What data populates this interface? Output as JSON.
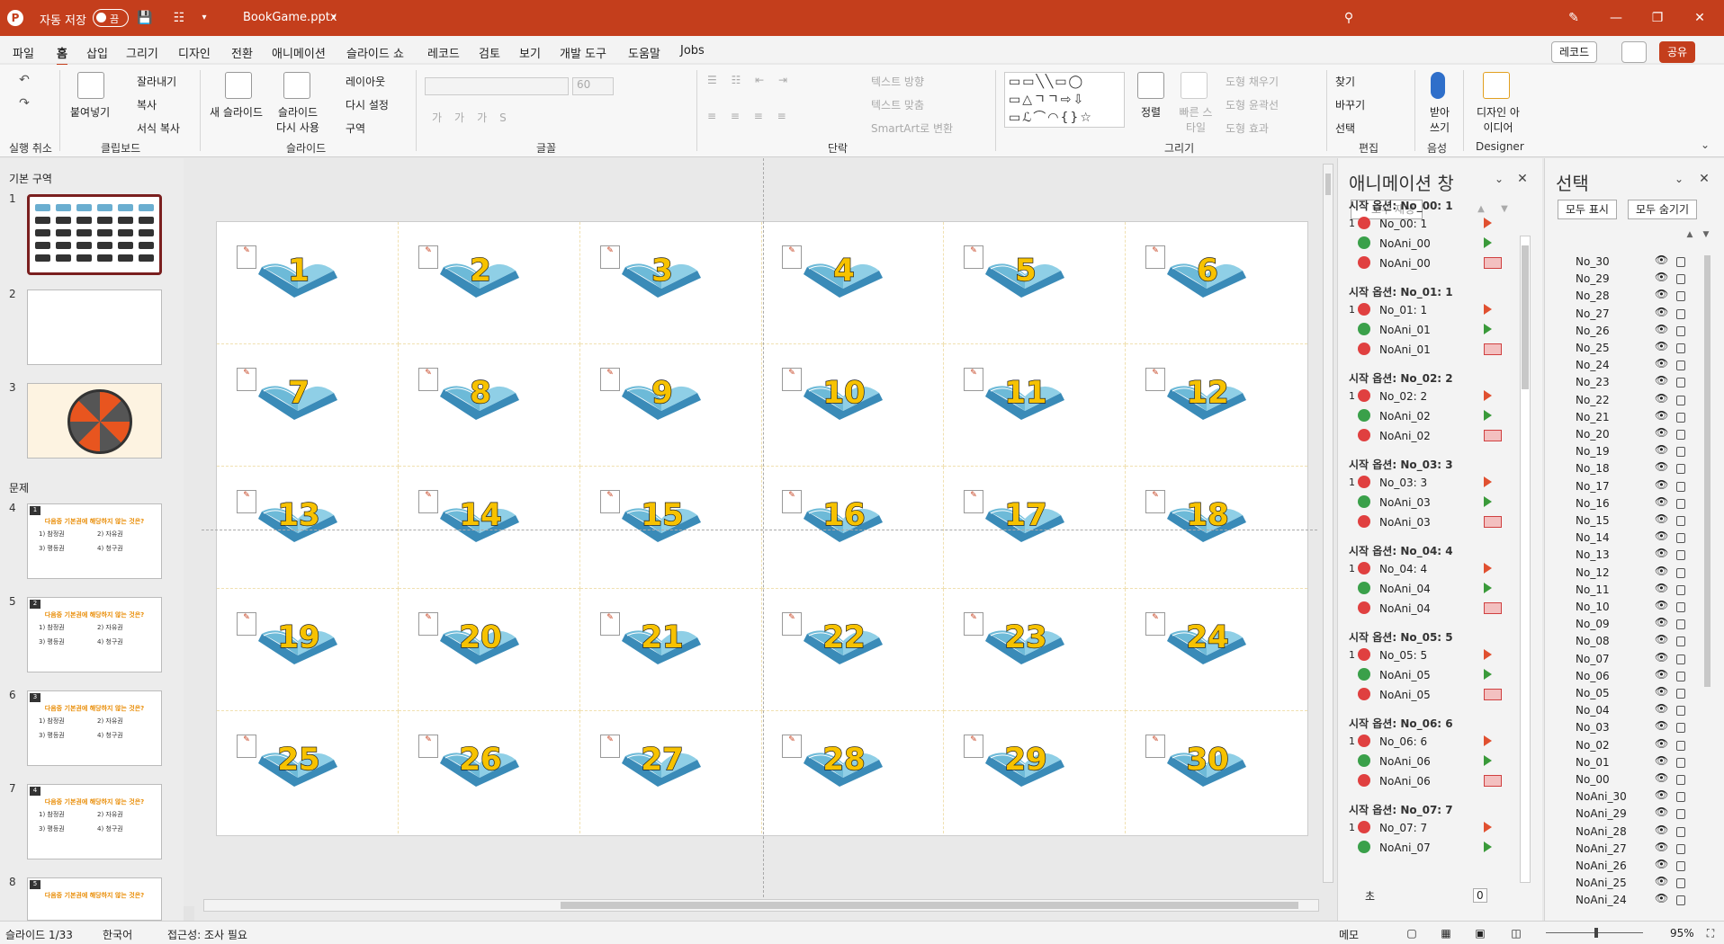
{
  "titlebar": {
    "autosave_label": "자동 저장",
    "autosave_state": "끔",
    "filename": "BookGame.pptx"
  },
  "menu": [
    "파일",
    "홈",
    "삽입",
    "그리기",
    "디자인",
    "전환",
    "애니메이션",
    "슬라이드 쇼",
    "레코드",
    "검토",
    "보기",
    "개발 도구",
    "도움말",
    "Jobs"
  ],
  "menu_active": "홈",
  "right_buttons": {
    "record": "레코드",
    "share": "공유"
  },
  "ribbon": {
    "undo_group": "실행 취소",
    "clipboard": {
      "paste": "붙여넣기",
      "cut": "잘라내기",
      "copy": "복사",
      "format_painter": "서식 복사",
      "group": "클립보드"
    },
    "slides": {
      "new_slide": "새 슬라이드",
      "reuse": "슬라이드 다시 사용",
      "layout": "레이아웃",
      "reset": "다시 설정",
      "section": "구역",
      "group": "슬라이드"
    },
    "font": {
      "size": "60",
      "group": "글꼴"
    },
    "paragraph": {
      "text_direction": "텍스트 방향",
      "align_text": "텍스트 맞춤",
      "smartart": "SmartArt로 변환",
      "group": "단락"
    },
    "drawing": {
      "arrange": "정렬",
      "quick_styles": "빠른 스타일",
      "fill": "도형 채우기",
      "outline": "도형 윤곽선",
      "effects": "도형 효과",
      "group": "그리기"
    },
    "editing": {
      "find": "찾기",
      "replace": "바꾸기",
      "select": "선택",
      "group": "편집"
    },
    "voice": {
      "dictate": "받아쓰기",
      "group": "음성"
    },
    "designer": {
      "ideas": "디자인 아이디어",
      "group": "Designer"
    }
  },
  "slides_panel": {
    "section1": "기본 구역",
    "section2": "문제",
    "thumb_question": "다음중 기본권에 해당하지 않는 것은?",
    "thumb_answers": [
      "1) 참정권",
      "2) 자유권",
      "3) 평등권",
      "4) 청구권"
    ],
    "numbers": [
      "1",
      "2",
      "3",
      "4",
      "5",
      "6",
      "7",
      "8"
    ],
    "q_badges": [
      "1",
      "2",
      "3",
      "4",
      "5"
    ]
  },
  "slide_numbers": [
    "1",
    "2",
    "3",
    "4",
    "5",
    "6",
    "7",
    "8",
    "9",
    "10",
    "11",
    "12",
    "13",
    "14",
    "15",
    "16",
    "17",
    "18",
    "19",
    "20",
    "21",
    "22",
    "23",
    "24",
    "25",
    "26",
    "27",
    "28",
    "29",
    "30"
  ],
  "animation_pane": {
    "title": "애니메이션 창",
    "play_all": "모두 재생",
    "groups": [
      {
        "header": "시작 옵션: No_00: 1",
        "items": [
          "No_00: 1",
          "NoAni_00",
          "NoAni_00"
        ]
      },
      {
        "header": "시작 옵션: No_01: 1",
        "items": [
          "No_01: 1",
          "NoAni_01",
          "NoAni_01"
        ]
      },
      {
        "header": "시작 옵션: No_02: 2",
        "items": [
          "No_02: 2",
          "NoAni_02",
          "NoAni_02"
        ]
      },
      {
        "header": "시작 옵션: No_03: 3",
        "items": [
          "No_03: 3",
          "NoAni_03",
          "NoAni_03"
        ]
      },
      {
        "header": "시작 옵션: No_04: 4",
        "items": [
          "No_04: 4",
          "NoAni_04",
          "NoAni_04"
        ]
      },
      {
        "header": "시작 옵션: No_05: 5",
        "items": [
          "No_05: 5",
          "NoAni_05",
          "NoAni_05"
        ]
      },
      {
        "header": "시작 옵션: No_06: 6",
        "items": [
          "No_06: 6",
          "NoAni_06",
          "NoAni_06"
        ]
      },
      {
        "header": "시작 옵션: No_07: 7",
        "items": [
          "No_07: 7",
          "NoAni_07"
        ]
      }
    ],
    "seconds_label": "초",
    "timeline_value": "0"
  },
  "selection_pane": {
    "title": "선택",
    "show_all": "모두 표시",
    "hide_all": "모두 숨기기",
    "items": [
      "No_30",
      "No_29",
      "No_28",
      "No_27",
      "No_26",
      "No_25",
      "No_24",
      "No_23",
      "No_22",
      "No_21",
      "No_20",
      "No_19",
      "No_18",
      "No_17",
      "No_16",
      "No_15",
      "No_14",
      "No_13",
      "No_12",
      "No_11",
      "No_10",
      "No_09",
      "No_08",
      "No_07",
      "No_06",
      "No_05",
      "No_04",
      "No_03",
      "No_02",
      "No_01",
      "No_00",
      "NoAni_30",
      "NoAni_29",
      "NoAni_28",
      "NoAni_27",
      "NoAni_26",
      "NoAni_25",
      "NoAni_24"
    ]
  },
  "statusbar": {
    "slide": "슬라이드 1/33",
    "lang": "한국어",
    "accessibility": "접근성: 조사 필요",
    "notes": "메모",
    "zoom": "95%"
  }
}
